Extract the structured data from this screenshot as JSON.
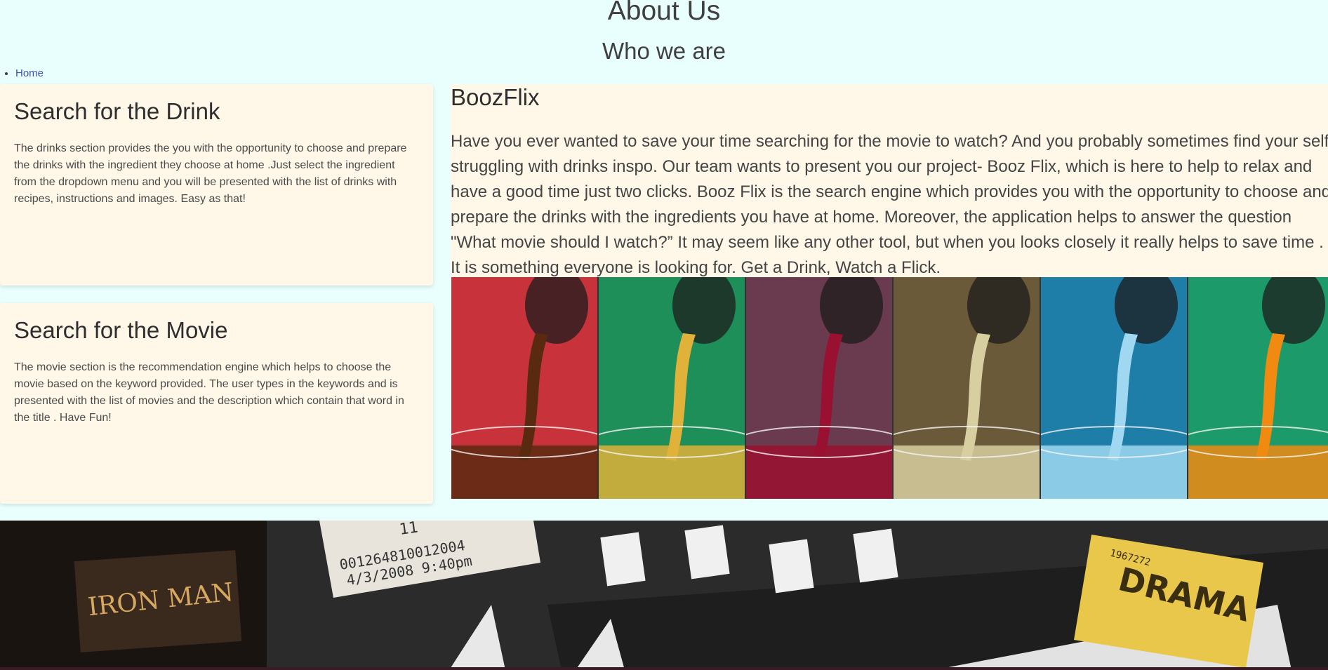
{
  "header": {
    "title": "About Us",
    "subtitle": "Who we are"
  },
  "breadcrumb": {
    "home": "Home"
  },
  "cards": {
    "drink": {
      "title": "Search for the Drink",
      "text": "The drinks section provides the you with the opportunity to choose and prepare the drinks with the ingredient they choose at home .Just select the ingredient from the dropdown menu and you will be presented with the list of drinks with recipes, instructions and images. Easy as that!"
    },
    "movie": {
      "title": "Search for the Movie",
      "text": "The movie section is the recommendation engine which helps to choose the movie based on the keyword provided. The user types in the keywords and is presented with the list of movies and the description which contain that word in the title . Have Fun!"
    }
  },
  "about": {
    "title": "BoozFlix",
    "text": "Have you ever wanted to save your time searching for the movie to watch? And you probably sometimes find your self struggling with drinks inspo. Our team wants to present you our project- Booz Flix, which is here to help to relax and have a good time just two clicks. Booz Flix is the search engine which provides you with the opportunity to choose and prepare the drinks with the ingredients you have at home. Moreover, the application helps to answer the question \"What movie should I watch?” It may seem like any other tool, but when you looks closely it really helps to save time . It is something everyone is looking for. Get a Drink, Watch a Flick."
  },
  "gallery": [
    {
      "name": "soda-pour-image",
      "bg": "#c8323a",
      "liquid": "#5a2a10"
    },
    {
      "name": "beer-pour-image",
      "bg": "#1f8f5a",
      "liquid": "#e0b23a"
    },
    {
      "name": "wine-pour-image",
      "bg": "#6a3a4e",
      "liquid": "#9a1030"
    },
    {
      "name": "champagne-pour-image",
      "bg": "#6a5a3a",
      "liquid": "#d8cfa0"
    },
    {
      "name": "water-pour-image",
      "bg": "#1f7ea8",
      "liquid": "#9fd8f0"
    },
    {
      "name": "juice-pour-image",
      "bg": "#1c9a6a",
      "liquid": "#f08a10"
    }
  ],
  "banner": {
    "ticket_number": "001264810012004",
    "ticket_date": "4/3/2008 9:40pm",
    "ticket_seat": "11",
    "drama_label": "DRAMA",
    "drama_code": "1967272",
    "poster_title": "IRON MAN"
  }
}
